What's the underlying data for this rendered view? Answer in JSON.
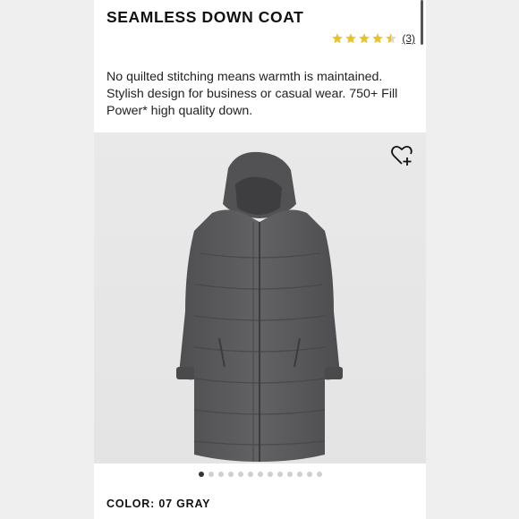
{
  "product": {
    "title": "SEAMLESS DOWN COAT",
    "rating_value": 4.5,
    "rating_max": 5,
    "review_count": "(3)",
    "description": "No quilted stitching means warmth is maintained. Stylish design for business or casual wear. 750+ Fill Power* high quality down.",
    "color_label": "COLOR: 07 GRAY"
  },
  "icons": {
    "favorite": "heart-plus-icon",
    "star": "star-icon"
  },
  "image_carousel": {
    "total_images": 13,
    "active_index": 0
  },
  "colors": {
    "star": "#e8c22a",
    "coat": "#5a5a5c",
    "background": "#ededed"
  }
}
